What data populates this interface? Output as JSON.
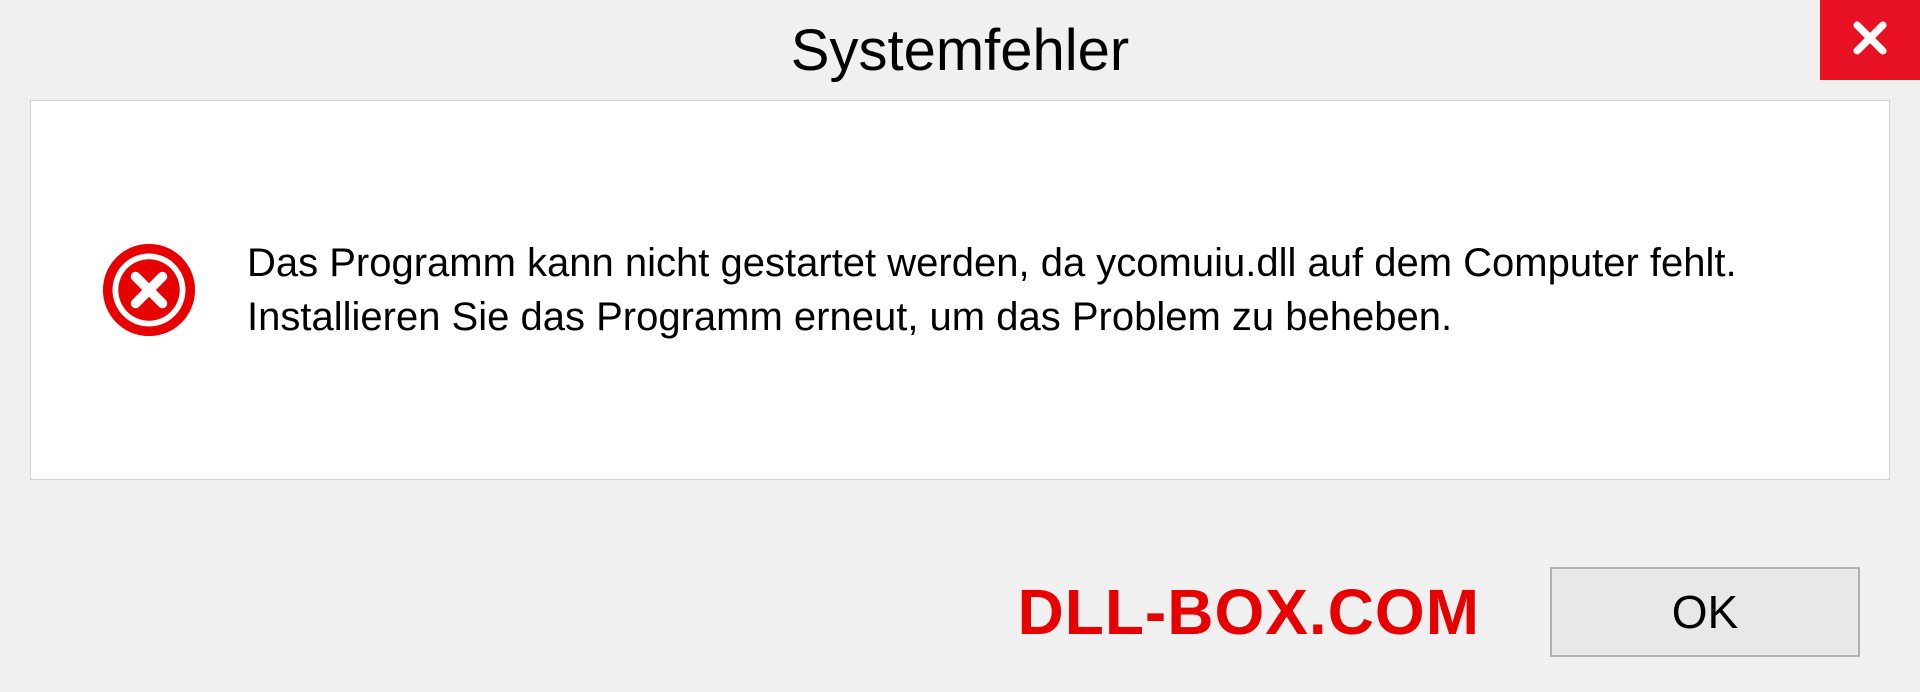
{
  "dialog": {
    "title": "Systemfehler",
    "message": "Das Programm kann nicht gestartet werden, da ycomuiu.dll auf dem Computer fehlt. Installieren Sie das Programm erneut, um das Problem zu beheben.",
    "ok_label": "OK"
  },
  "brand": {
    "text": "DLL-BOX.COM"
  },
  "colors": {
    "close_bg": "#e81123",
    "error_icon": "#e60000",
    "brand_color": "#e60000"
  }
}
